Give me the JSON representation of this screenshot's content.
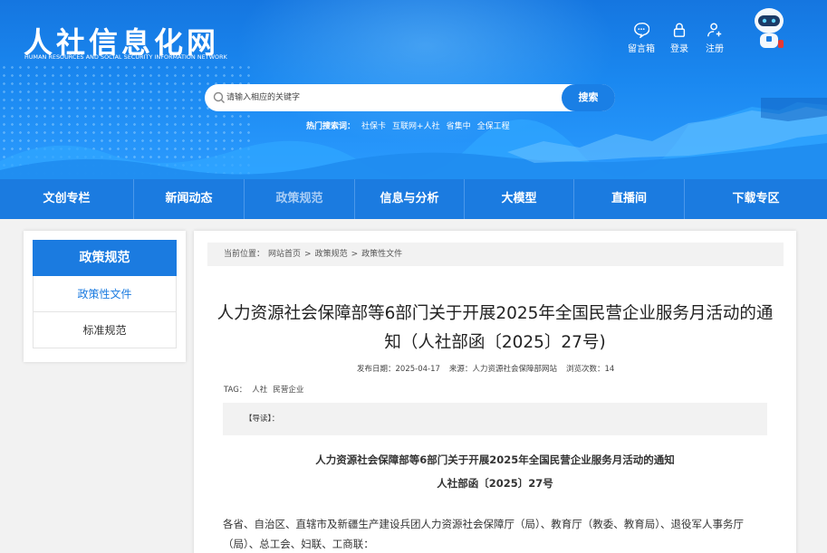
{
  "site": {
    "title": "人社信息化网",
    "subtitle": "HUMAN RESOURCES AND SOCIAL SECURITY INFORMATION NETWORK"
  },
  "top_links": {
    "message": "留言箱",
    "login": "登录",
    "register": "注册"
  },
  "search": {
    "placeholder": "请输入相应的关键字",
    "button": "搜索",
    "hot_label": "热门搜索词：",
    "hot_terms": [
      "社保卡",
      "互联网+人社",
      "省集中",
      "全保工程"
    ]
  },
  "nav": {
    "items": [
      "文创专栏",
      "新闻动态",
      "政策规范",
      "信息与分析",
      "大模型",
      "直播间",
      "下载专区"
    ],
    "active": "政策规范"
  },
  "sidebar": {
    "heading": "政策规范",
    "items": [
      "政策性文件",
      "标准规范"
    ]
  },
  "breadcrumb": {
    "label": "当前位置：",
    "items": [
      "网站首页",
      "政策规范",
      "政策性文件"
    ],
    "separator": ">"
  },
  "article": {
    "title": "人力资源社会保障部等6部门关于开展2025年全国民营企业服务月活动的通知（人社部函〔2025〕27号)",
    "publish_label": "发布日期：",
    "publish_date": "2025-04-17",
    "source_label": "来源：",
    "source": "人力资源社会保障部网站",
    "views_label": "浏览次数：",
    "views": "14",
    "tag_label": "TAG：",
    "tags": [
      "人社",
      "民营企业"
    ],
    "guide_label": "【导读】："
  },
  "document": {
    "title": "人力资源社会保障部等6部门关于开展2025年全国民营企业服务月活动的通知",
    "number": "人社部函〔2025〕27号",
    "body": "各省、自治区、直辖市及新疆生产建设兵团人力资源社会保障厅（局）、教育厅（教委、教育局）、退役军人事务厅（局）、总工会、妇联、工商联："
  },
  "colors": {
    "primary": "#1b7be0",
    "banner_top": "#1576e0",
    "page_bg": "#f2f2f2"
  }
}
